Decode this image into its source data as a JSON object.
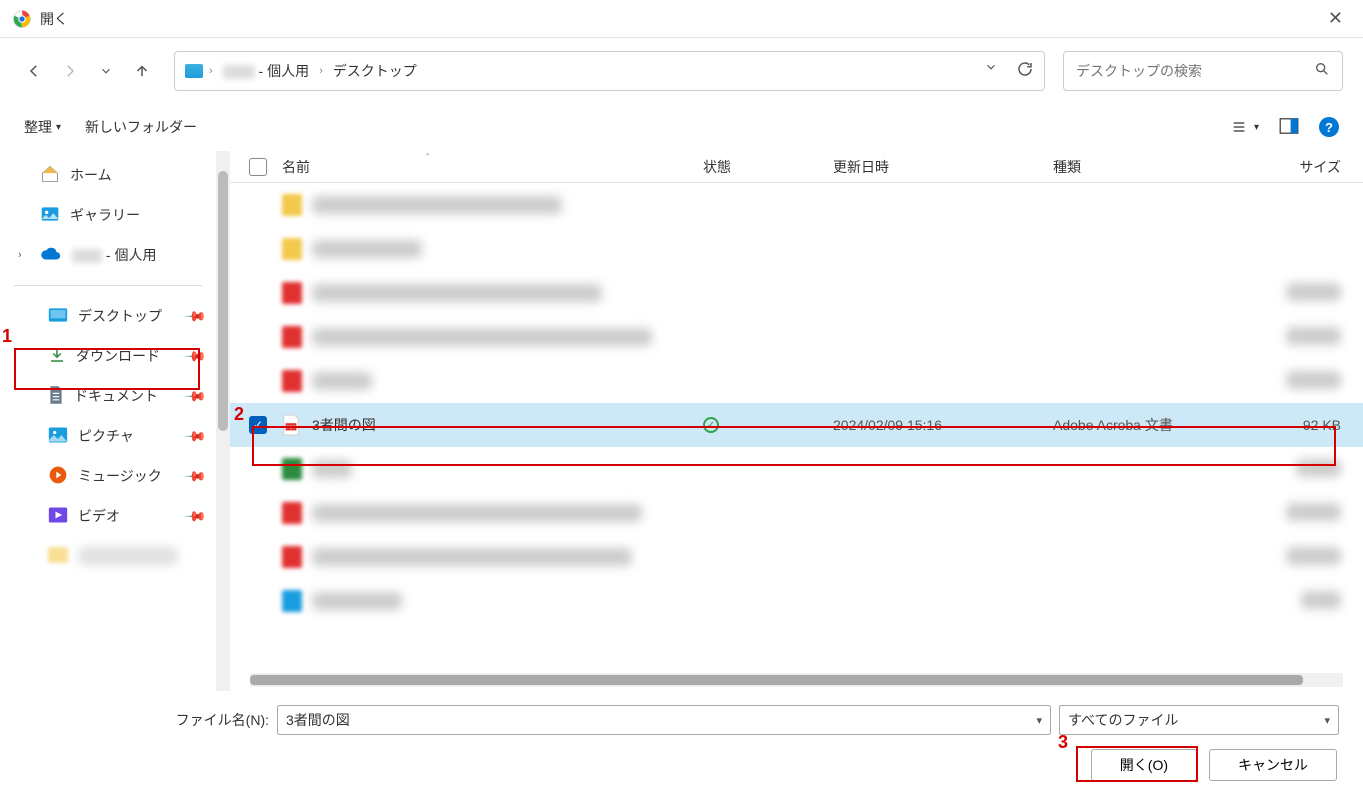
{
  "window": {
    "title": "開く"
  },
  "breadcrumb": {
    "user_suffix": " - 個人用",
    "current": "デスクトップ"
  },
  "search": {
    "placeholder": "デスクトップの検索"
  },
  "toolbar": {
    "organize": "整理",
    "new_folder": "新しいフォルダー"
  },
  "sidebar": {
    "home": "ホーム",
    "gallery": "ギャラリー",
    "onedrive_suffix": " - 個人用",
    "desktop": "デスクトップ",
    "downloads": "ダウンロード",
    "documents": "ドキュメント",
    "pictures": "ピクチャ",
    "music": "ミュージック",
    "videos": "ビデオ"
  },
  "columns": {
    "name": "名前",
    "state": "状態",
    "date": "更新日時",
    "type": "種類",
    "size": "サイズ"
  },
  "selected_file": {
    "name": "3者間の図",
    "date": "2024/02/09 15:16",
    "type": "Adobe Acroba 文書",
    "size": "92 KB"
  },
  "footer": {
    "filename_label": "ファイル名(N):",
    "filename_value": "3者間の図",
    "filter": "すべてのファイル",
    "open": "開く(O)",
    "cancel": "キャンセル"
  },
  "annotations": {
    "n1": "1",
    "n2": "2",
    "n3": "3"
  }
}
